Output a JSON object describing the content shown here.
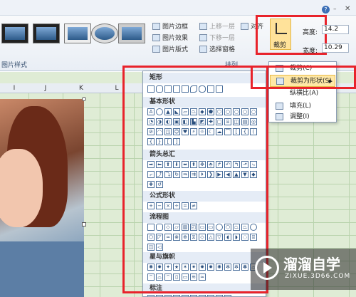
{
  "ribbon": {
    "style_group": "图片样式",
    "border_btn": "图片边框",
    "effect_btn": "图片效果",
    "layout_btn": "图片版式",
    "up_btn": "上移一层",
    "down_btn": "下移一层",
    "pane_btn": "选择窗格",
    "align_btn": "对齐",
    "arrange_group": "排列",
    "crop_btn": "裁剪",
    "height_label": "高度:",
    "height_val": "14.2",
    "width_label": "宽度:",
    "width_val": "10.29"
  },
  "columns": [
    "I",
    "J",
    "K",
    "L"
  ],
  "shapes_menu": {
    "cat_rect": "矩形",
    "cat_basic": "基本形状",
    "cat_arrows": "箭头总汇",
    "cat_formula": "公式形状",
    "cat_flow": "流程图",
    "cat_stars": "星与旗帜",
    "cat_callout": "标注"
  },
  "context_menu": {
    "item1": "裁剪(C)",
    "item2": "裁剪为形状(S)",
    "item3": "纵横比(A)",
    "item4": "填充(L)",
    "item5": "调整(I)"
  },
  "watermark": {
    "title": "溜溜自学",
    "url": "ZIXUE.3D66.COM"
  }
}
